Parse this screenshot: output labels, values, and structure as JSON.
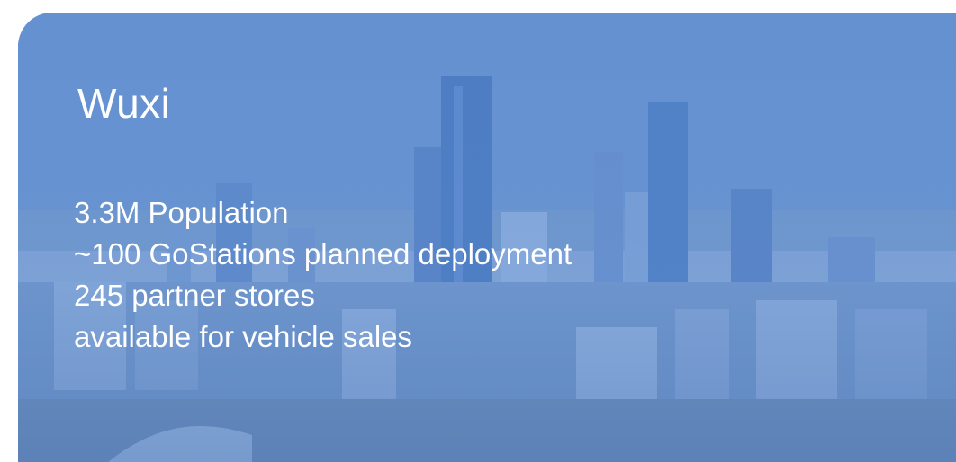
{
  "slide": {
    "title": "Wuxi",
    "facts": [
      "3.3M Population",
      "~100 GoStations planned deployment",
      "245 partner stores",
      "available for vehicle sales"
    ]
  },
  "colors": {
    "overlay_blue": "#6c97d4",
    "text": "#ffffff"
  }
}
